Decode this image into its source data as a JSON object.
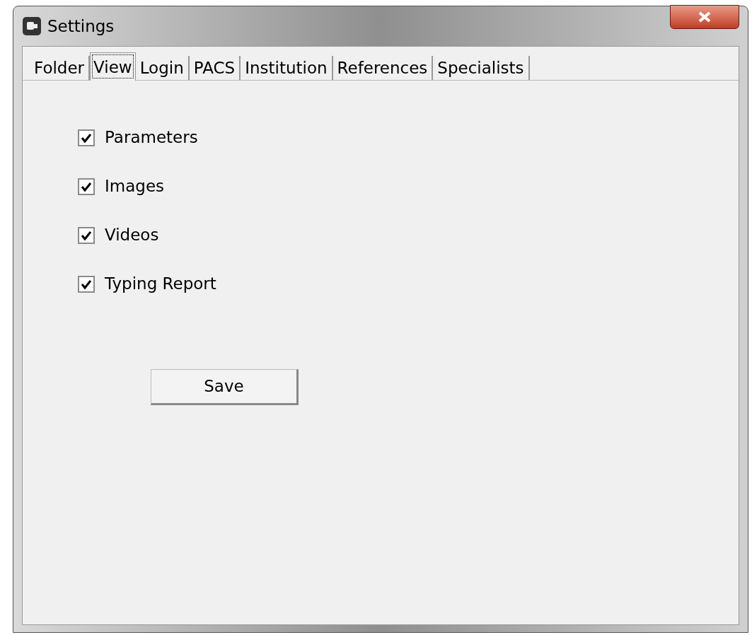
{
  "window": {
    "title": "Settings"
  },
  "tabs": [
    {
      "label": "Folder",
      "selected": false
    },
    {
      "label": "View",
      "selected": true
    },
    {
      "label": "Login",
      "selected": false
    },
    {
      "label": "PACS",
      "selected": false
    },
    {
      "label": "Institution",
      "selected": false
    },
    {
      "label": "References",
      "selected": false
    },
    {
      "label": "Specialists",
      "selected": false
    }
  ],
  "options": [
    {
      "label": "Parameters",
      "checked": true
    },
    {
      "label": "Images",
      "checked": true
    },
    {
      "label": "Videos",
      "checked": true
    },
    {
      "label": "Typing Report",
      "checked": true
    }
  ],
  "buttons": [
    "Save"
  ]
}
